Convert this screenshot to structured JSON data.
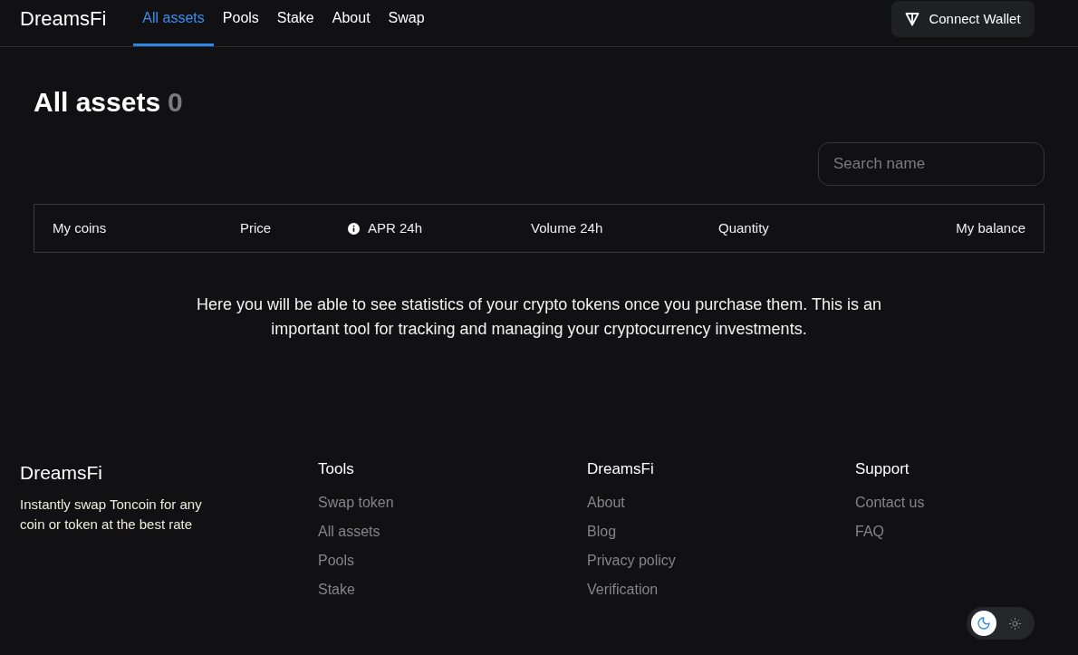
{
  "header": {
    "logo": "DreamsFi",
    "nav": [
      {
        "label": "All assets",
        "selected": true
      },
      {
        "label": "Pools",
        "selected": false
      },
      {
        "label": "Stake",
        "selected": false
      },
      {
        "label": "About",
        "selected": false
      },
      {
        "label": "Swap",
        "selected": false
      }
    ],
    "connect_button": "Connect Wallet"
  },
  "page": {
    "title": "All assets",
    "count": "0",
    "search": {
      "placeholder": "Search name"
    },
    "table": {
      "columns": [
        {
          "label": "My coins",
          "has_info": false
        },
        {
          "label": "Price",
          "has_info": false
        },
        {
          "label": "APR 24h",
          "has_info": true
        },
        {
          "label": "Volume 24h",
          "has_info": false
        },
        {
          "label": "Quantity",
          "has_info": false
        },
        {
          "label": "My balance",
          "has_info": false
        }
      ]
    },
    "empty_message": "Here you will be able to see statistics of your crypto tokens once you purchase them. This is an important tool for tracking and managing your cryptocurrency investments."
  },
  "footer": {
    "brand": "DreamsFi",
    "tagline": "Instantly swap Toncoin for any coin or token at the best rate",
    "columns": [
      {
        "title": "Tools",
        "links": [
          "Swap token",
          "All assets",
          "Pools",
          "Stake"
        ]
      },
      {
        "title": "DreamsFi",
        "links": [
          "About",
          "Blog",
          "Privacy policy",
          "Verification"
        ]
      },
      {
        "title": "Support",
        "links": [
          "Contact us",
          "FAQ"
        ]
      }
    ]
  },
  "theme_toggle": {
    "options": [
      {
        "kind": "dark",
        "selected": true
      },
      {
        "kind": "light",
        "selected": false
      }
    ]
  }
}
